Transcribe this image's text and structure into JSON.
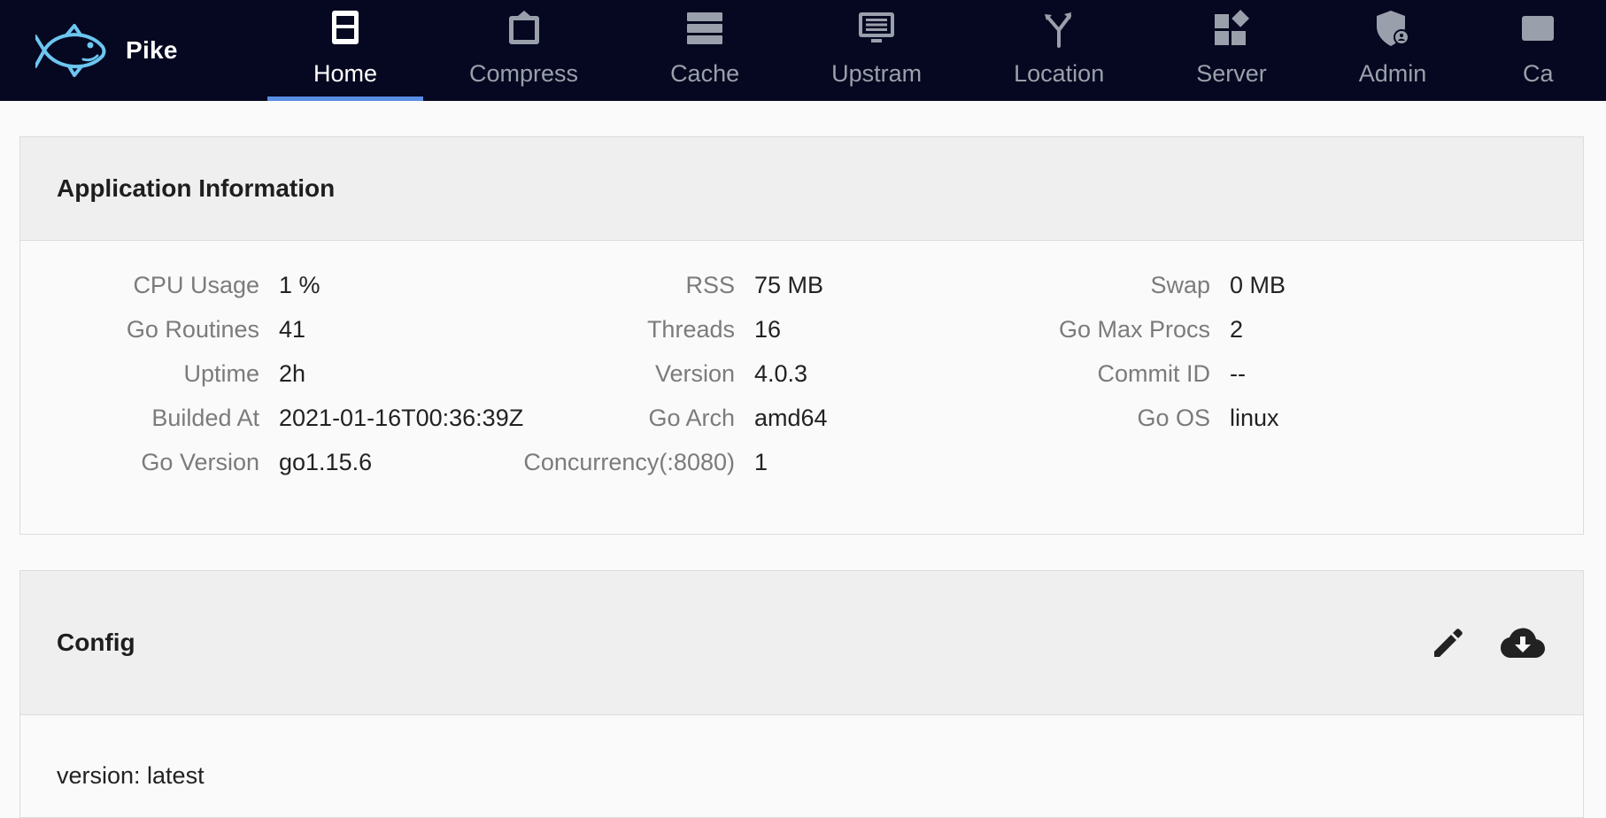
{
  "app": {
    "name": "Pike"
  },
  "nav": {
    "items": [
      {
        "label": "Home",
        "icon": "home-icon",
        "active": true
      },
      {
        "label": "Compress",
        "icon": "compress-icon",
        "active": false
      },
      {
        "label": "Cache",
        "icon": "cache-icon",
        "active": false
      },
      {
        "label": "Upstram",
        "icon": "upstream-icon",
        "active": false
      },
      {
        "label": "Location",
        "icon": "location-icon",
        "active": false
      },
      {
        "label": "Server",
        "icon": "server-icon",
        "active": false
      },
      {
        "label": "Admin",
        "icon": "admin-icon",
        "active": false
      },
      {
        "label": "Ca",
        "icon": "more-icon",
        "active": false
      }
    ],
    "active_color": "#5b8ee6"
  },
  "app_info": {
    "title": "Application Information",
    "rows": [
      [
        {
          "label": "CPU Usage",
          "value": "1 %"
        },
        {
          "label": "RSS",
          "value": "75 MB"
        },
        {
          "label": "Swap",
          "value": "0 MB"
        }
      ],
      [
        {
          "label": "Go Routines",
          "value": "41"
        },
        {
          "label": "Threads",
          "value": "16"
        },
        {
          "label": "Go Max Procs",
          "value": "2"
        }
      ],
      [
        {
          "label": "Uptime",
          "value": "2h"
        },
        {
          "label": "Version",
          "value": "4.0.3"
        },
        {
          "label": "Commit ID",
          "value": "--"
        }
      ],
      [
        {
          "label": "Builded At",
          "value": "2021-01-16T00:36:39Z"
        },
        {
          "label": "Go Arch",
          "value": "amd64"
        },
        {
          "label": "Go OS",
          "value": "linux"
        }
      ],
      [
        {
          "label": "Go Version",
          "value": "go1.15.6"
        },
        {
          "label": "Concurrency(:8080)",
          "value": "1"
        }
      ]
    ]
  },
  "config": {
    "title": "Config",
    "actions": [
      {
        "name": "edit-icon"
      },
      {
        "name": "cloud-download-icon"
      }
    ],
    "lines": [
      "version: latest"
    ]
  }
}
